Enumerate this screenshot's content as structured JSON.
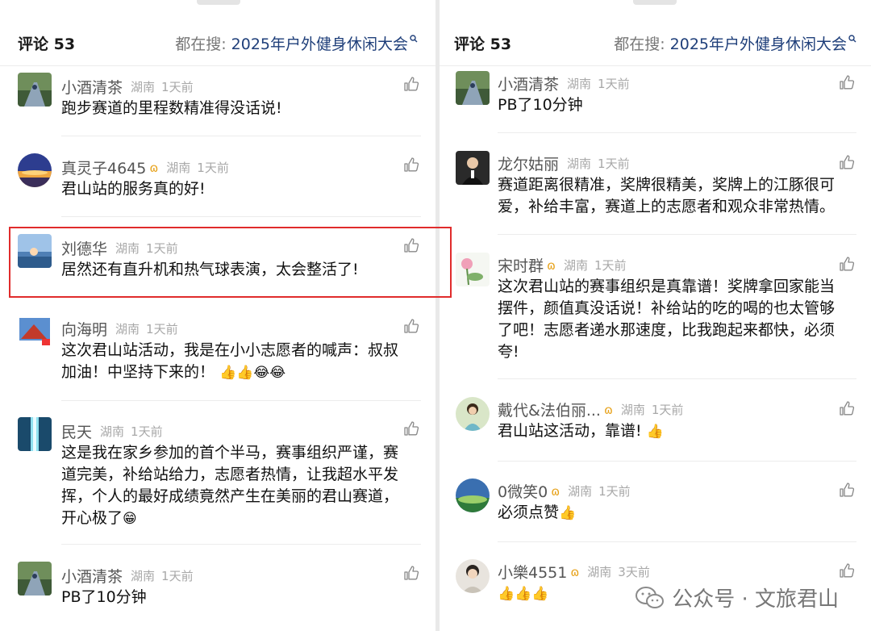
{
  "header": {
    "title": "评论 53",
    "search_prefix": "都在搜:",
    "search_keyword": "2025年户外健身休闲大会"
  },
  "left_comments": [
    {
      "name": "小酒清茶",
      "badge": "",
      "location": "湖南",
      "time": "1天前",
      "text": "跑步赛道的里程数精准得没话说!"
    },
    {
      "name": "真灵子4645",
      "badge": "ɷ",
      "location": "湖南",
      "time": "1天前",
      "text": "君山站的服务真的好!"
    },
    {
      "name": "刘德华",
      "badge": "",
      "location": "湖南",
      "time": "1天前",
      "text": "居然还有直升机和热气球表演，太会整活了!"
    },
    {
      "name": "向海明",
      "badge": "",
      "location": "湖南",
      "time": "1天前",
      "text_lines": [
        "这次君山站活动，我是在小小志愿者的喊声：叔叔",
        "加油！中坚持下来的！"
      ],
      "emoji": "👍👍😂😂"
    },
    {
      "name": "民天",
      "badge": "",
      "location": "湖南",
      "time": "1天前",
      "text_lines": [
        "这是我在家乡参加的首个半马，赛事组织严谨，赛",
        "道完美，补给站给力，志愿者热情，让我超水平发",
        "挥，个人的最好成绩竟然产生在美丽的君山赛道，",
        "开心极了"
      ],
      "emoji": "😁"
    },
    {
      "name": "小酒清茶",
      "badge": "",
      "location": "湖南",
      "time": "1天前",
      "text": "PB了10分钟"
    }
  ],
  "right_comments": [
    {
      "name": "小酒清茶",
      "badge": "",
      "location": "湖南",
      "time": "1天前",
      "text": "PB了10分钟"
    },
    {
      "name": "龙尔姑丽",
      "badge": "",
      "location": "湖南",
      "time": "1天前",
      "text_lines": [
        "赛道距离很精准，奖牌很精美，奖牌上的江豚很可",
        "爱，补给丰富，赛道上的志愿者和观众非常热情。"
      ]
    },
    {
      "name": "宋时群",
      "badge": "ɷ",
      "location": "湖南",
      "time": "1天前",
      "text_lines": [
        "这次君山站的赛事组织是真靠谱！奖牌拿回家能当",
        "摆件，颜值真没话说！补给站的吃的喝的也太管够",
        "了吧！志愿者递水那速度，比我跑起来都快，必须",
        "夸!"
      ]
    },
    {
      "name": "戴代&法伯丽...",
      "badge": "ɷ",
      "location": "湖南",
      "time": "1天前",
      "text": "君山站这活动，靠谱!",
      "emoji": "👍"
    },
    {
      "name": "0微笑0",
      "badge": "ɷ",
      "location": "湖南",
      "time": "1天前",
      "text": "必须点赞",
      "emoji": "👍"
    },
    {
      "name": "小樂4551",
      "badge": "ɷ",
      "location": "湖南",
      "time": "3天前",
      "text": "",
      "emoji": "👍👍👍"
    }
  ],
  "watermark": "公众号 · 文旅君山",
  "colors": {
    "highlight_border": "#e02c2c",
    "keyword": "#1f3f7a",
    "badge": "#e7a21a"
  },
  "icons": {
    "like": "thumb-up-icon",
    "search": "search-icon",
    "badge": "vip-badge-icon",
    "watermark": "wechat-icon"
  }
}
